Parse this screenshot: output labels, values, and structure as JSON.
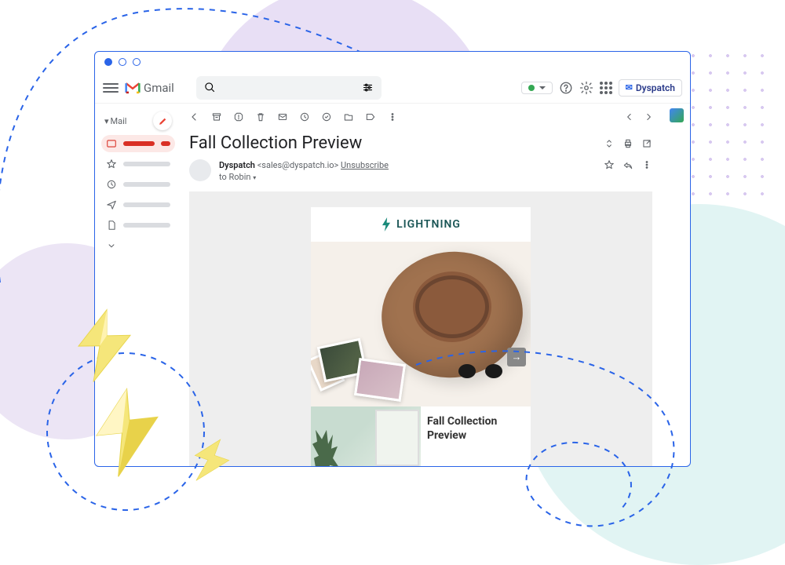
{
  "app": {
    "name": "Gmail"
  },
  "header": {
    "search_placeholder": "",
    "dyspatch_label": "Dyspatch"
  },
  "sidebar": {
    "mail_label": "Mail"
  },
  "email": {
    "subject": "Fall Collection Preview",
    "sender_name": "Dyspatch",
    "sender_email": "<sales@dyspatch.io>",
    "unsubscribe": "Unsubscribe",
    "recipient_line": "to Robin",
    "brand": "LIGHTNING",
    "content_title": "Fall Collection Preview",
    "next_arrow": "→"
  }
}
